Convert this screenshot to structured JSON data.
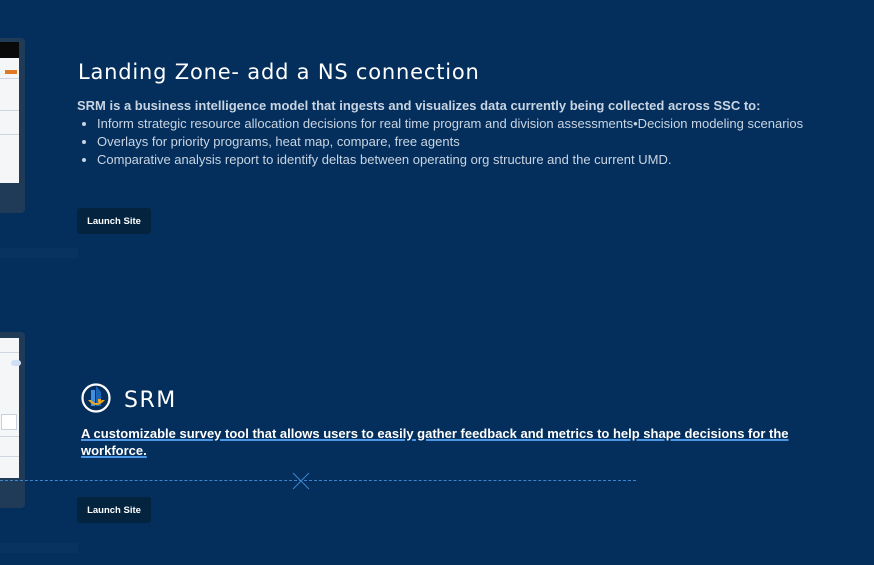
{
  "section1": {
    "title": "Landing Zone- add a NS connection",
    "lead": "SRM is a business intelligence model that ingests and visualizes data currently being collected across SSC to:",
    "bullets": [
      "Inform strategic resource allocation decisions for real time program and division assessments•Decision modeling scenarios",
      "Overlays for priority programs, heat map, compare, free agents",
      "Comparative analysis report to identify deltas between operating org structure and the current UMD."
    ],
    "button_label": "Launch Site"
  },
  "section2": {
    "brand_name": "SRM",
    "brand_icon": "srm-logo-icon",
    "description": "A customizable survey tool that allows users to easily gather feedback and metrics to help shape decisions for the workforce.",
    "button_label": "Launch Site"
  },
  "colors": {
    "background": "#042f5c",
    "button": "#03233f",
    "accent_line": "#4a97e6"
  }
}
